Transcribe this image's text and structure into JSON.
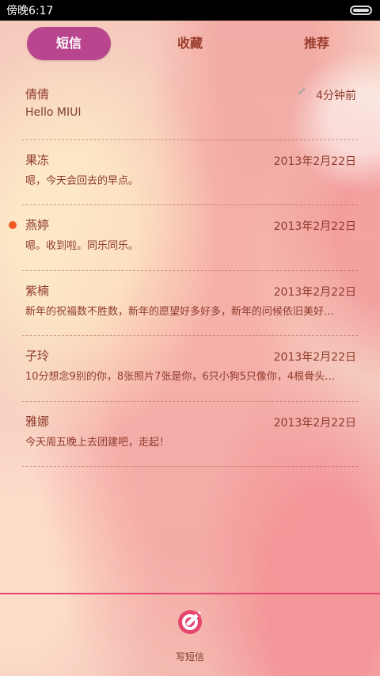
{
  "status_bar": {
    "time": "傍晚6:17"
  },
  "tabs": [
    {
      "label": "短信",
      "active": true
    },
    {
      "label": "收藏",
      "active": false
    },
    {
      "label": "推荐",
      "active": false
    }
  ],
  "messages": [
    {
      "name": "倩倩",
      "preview": "Hello MIUI",
      "time": "4分钟前",
      "draft": true,
      "unread": false
    },
    {
      "name": "果冻",
      "preview": "嗯，今天会回去的早点。",
      "time": "2013年2月22日",
      "draft": false,
      "unread": false
    },
    {
      "name": "燕婷",
      "preview": "嗯。收到啦。同乐同乐。",
      "time": "2013年2月22日",
      "draft": false,
      "unread": true
    },
    {
      "name": "紫楠",
      "preview": "新年的祝福数不胜数，新年的愿望好多好多，新年的问候依旧美好…",
      "time": "2013年2月22日",
      "draft": false,
      "unread": false
    },
    {
      "name": "子玲",
      "preview": "10分想念9别的你，8张照片7张是你，6只小狗5只像你，4根骨头…",
      "time": "2013年2月22日",
      "draft": false,
      "unread": false
    },
    {
      "name": "雅娜",
      "preview": "今天周五晚上去团建吧，走起！",
      "time": "2013年2月22日",
      "draft": false,
      "unread": false
    }
  ],
  "compose": {
    "label": "写短信"
  },
  "colors": {
    "accent": "#b8458e",
    "text": "#8f3b2c",
    "unread": "#ef5a22",
    "divider": "#e6466e"
  }
}
